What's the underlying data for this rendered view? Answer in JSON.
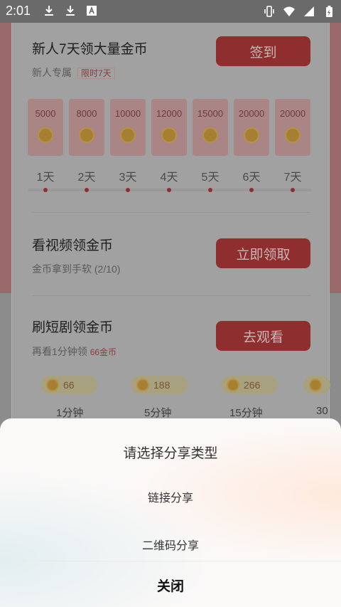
{
  "status_bar": {
    "time": "2:01",
    "left_icons": [
      "download-icon",
      "download-icon",
      "font-icon"
    ],
    "right_icons": [
      "vibrate-icon",
      "wifi-icon",
      "signal-icon",
      "battery-charging-icon"
    ]
  },
  "signin": {
    "title": "新人7天领大量金币",
    "subtitle": "新人专属",
    "tag": "限时7天",
    "button": "签到",
    "days": [
      {
        "coins": "5000",
        "label": "1天"
      },
      {
        "coins": "8000",
        "label": "2天"
      },
      {
        "coins": "10000",
        "label": "3天"
      },
      {
        "coins": "12000",
        "label": "4天"
      },
      {
        "coins": "15000",
        "label": "5天"
      },
      {
        "coins": "20000",
        "label": "6天"
      },
      {
        "coins": "20000",
        "label": "7天"
      }
    ]
  },
  "video_task": {
    "title": "看视频领金币",
    "subtitle": "金币拿到手软 (2/10)",
    "button": "立即领取"
  },
  "drama_task": {
    "title": "刷短剧领金币",
    "subtitle_prefix": "再看1分钟领 ",
    "subtitle_highlight": "66金币",
    "button": "去观看",
    "rewards": [
      {
        "value": "66",
        "label": "1分钟"
      },
      {
        "value": "188",
        "label": "5分钟"
      },
      {
        "value": "266",
        "label": "15分钟"
      },
      {
        "value": "",
        "label": "30"
      }
    ]
  },
  "share_sheet": {
    "title": "请选择分享类型",
    "options": [
      "链接分享",
      "二维码分享"
    ],
    "close": "关闭"
  },
  "colors": {
    "accent_red": "#d94a4a",
    "dimmed_red": "#8f2e2e",
    "coin_gold": "#e6a81e"
  }
}
